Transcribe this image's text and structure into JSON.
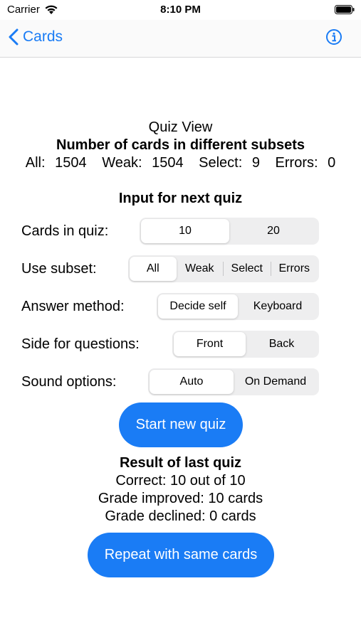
{
  "status_bar": {
    "carrier": "Carrier",
    "time": "8:10 PM"
  },
  "nav": {
    "back_label": "Cards"
  },
  "header": {
    "title": "Quiz View",
    "subtitle": "Number of cards in different subsets",
    "counts": [
      {
        "label": "All:",
        "value": "1504"
      },
      {
        "label": "Weak:",
        "value": "1504"
      },
      {
        "label": "Select:",
        "value": "9"
      },
      {
        "label": "Errors:",
        "value": "0"
      }
    ]
  },
  "input_section": {
    "title": "Input for next quiz",
    "cards_in_quiz": {
      "label": "Cards in quiz:",
      "options": [
        "10",
        "20"
      ],
      "selected": "10"
    },
    "use_subset": {
      "label": "Use subset:",
      "options": [
        "All",
        "Weak",
        "Select",
        "Errors"
      ],
      "selected": "All"
    },
    "answer_method": {
      "label": "Answer method:",
      "options": [
        "Decide self",
        "Keyboard"
      ],
      "selected": "Decide self"
    },
    "side_for_questions": {
      "label": "Side for questions:",
      "options": [
        "Front",
        "Back"
      ],
      "selected": "Front"
    },
    "sound_options": {
      "label": "Sound options:",
      "options": [
        "Auto",
        "On Demand"
      ],
      "selected": "Auto"
    }
  },
  "start_button": "Start new quiz",
  "result_section": {
    "title": "Result of last quiz",
    "correct": "Correct: 10 out of 10",
    "improved": "Grade improved: 10 cards",
    "declined": "Grade declined: 0 cards"
  },
  "repeat_button": "Repeat with same cards",
  "colors": {
    "accent": "#1a7cf5",
    "segment_bg": "#eeeeef"
  }
}
